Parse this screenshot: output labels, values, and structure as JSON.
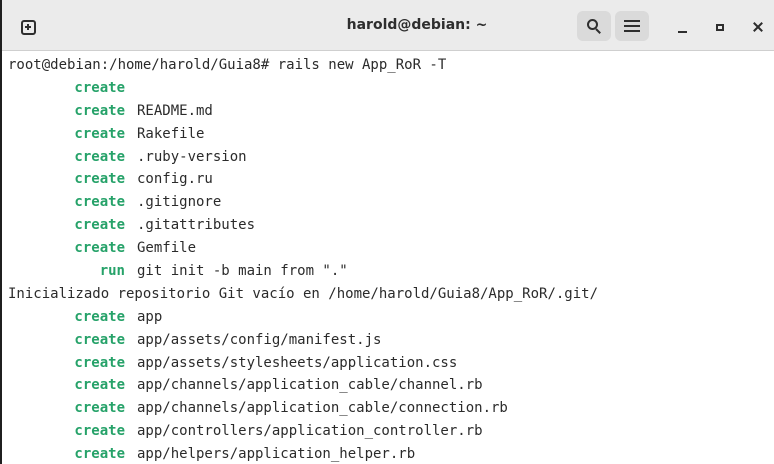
{
  "window": {
    "title": "harold@debian: ~"
  },
  "icons": {
    "new_tab": "new-tab-icon",
    "search": "search-icon",
    "menu": "hamburger-menu-icon",
    "minimize": "minimize-icon",
    "maximize": "maximize-icon",
    "close": "close-icon"
  },
  "colors": {
    "action_green": "#26a269",
    "text": "#2b2b2b",
    "titlebar": "#ebebeb"
  },
  "terminal": {
    "prompt_line": "root@debian:/home/harold/Guia8# rails new App_RoR -T",
    "lines": [
      {
        "action": "create",
        "path": ""
      },
      {
        "action": "create",
        "path": "README.md"
      },
      {
        "action": "create",
        "path": "Rakefile"
      },
      {
        "action": "create",
        "path": ".ruby-version"
      },
      {
        "action": "create",
        "path": "config.ru"
      },
      {
        "action": "create",
        "path": ".gitignore"
      },
      {
        "action": "create",
        "path": ".gitattributes"
      },
      {
        "action": "create",
        "path": "Gemfile"
      },
      {
        "action": "run",
        "path": "git init -b main from \".\""
      }
    ],
    "git_output": "Inicializado repositorio Git vacío en /home/harold/Guia8/App_RoR/.git/",
    "lines_after": [
      {
        "action": "create",
        "path": "app"
      },
      {
        "action": "create",
        "path": "app/assets/config/manifest.js"
      },
      {
        "action": "create",
        "path": "app/assets/stylesheets/application.css"
      },
      {
        "action": "create",
        "path": "app/channels/application_cable/channel.rb"
      },
      {
        "action": "create",
        "path": "app/channels/application_cable/connection.rb"
      },
      {
        "action": "create",
        "path": "app/controllers/application_controller.rb"
      },
      {
        "action": "create",
        "path": "app/helpers/application_helper.rb"
      }
    ]
  }
}
